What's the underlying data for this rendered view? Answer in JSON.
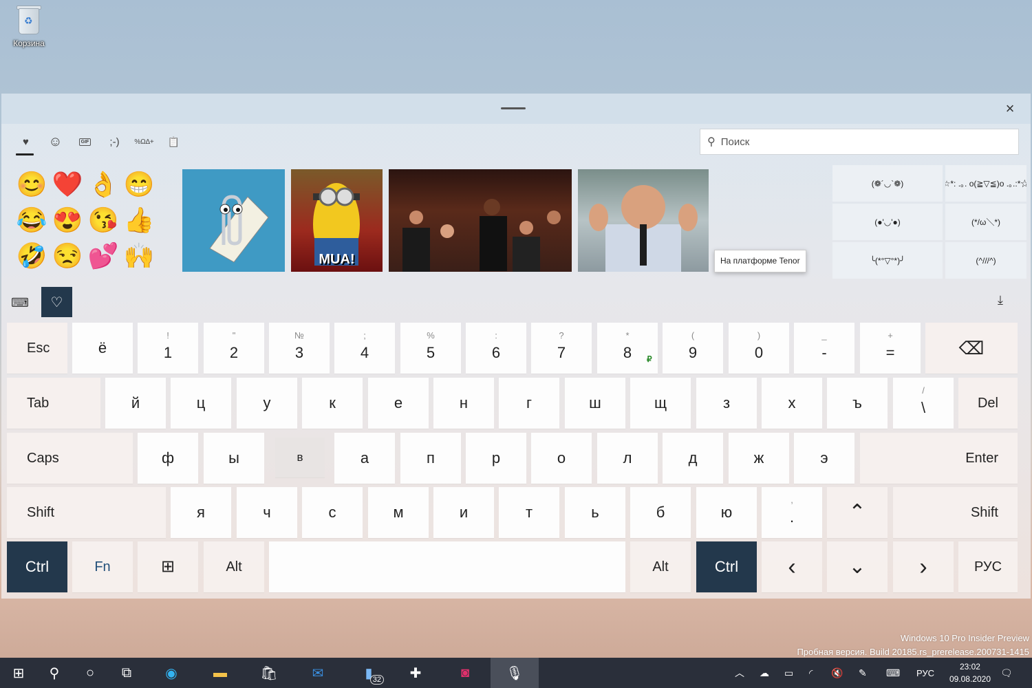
{
  "desktop": {
    "recycle_bin_label": "Корзина"
  },
  "panel": {
    "tabs": [
      {
        "name": "recent",
        "glyph": "♥"
      },
      {
        "name": "emoji",
        "glyph": "☺"
      },
      {
        "name": "gif",
        "glyph": "GIF"
      },
      {
        "name": "kaomoji",
        "glyph": ";-)"
      },
      {
        "name": "symbols",
        "glyph": "%Ω∆+"
      },
      {
        "name": "clipboard",
        "glyph": "📋"
      }
    ],
    "search_placeholder": "Поиск",
    "emojis": [
      "😊",
      "❤️",
      "👌",
      "😁",
      "😂",
      "😍",
      "😘",
      "👍",
      "🤣",
      "😒",
      "💕",
      "🙌"
    ],
    "gif_caption": "MUA!",
    "tenor_tooltip": "На платформе Tenor",
    "kaomoji": [
      "(❁´◡`❁)",
      "☆*: .｡. o(≧▽≦)o .｡.:*☆",
      "(●'◡'●)",
      "(*/ω＼*)",
      "╰(*°▽°*)╯",
      "(^///^)"
    ]
  },
  "keyboard": {
    "row1": [
      {
        "shift": "",
        "main": "Esc"
      },
      {
        "shift": "",
        "main": "ё"
      },
      {
        "shift": "!",
        "main": "1"
      },
      {
        "shift": "\"",
        "main": "2"
      },
      {
        "shift": "№",
        "main": "3"
      },
      {
        "shift": ";",
        "main": "4"
      },
      {
        "shift": "%",
        "main": "5"
      },
      {
        "shift": ":",
        "main": "6"
      },
      {
        "shift": "?",
        "main": "7"
      },
      {
        "shift": "*",
        "main": "8",
        "extra": "₽"
      },
      {
        "shift": "(",
        "main": "9"
      },
      {
        "shift": ")",
        "main": "0"
      },
      {
        "shift": "_",
        "main": "-"
      },
      {
        "shift": "+",
        "main": "="
      },
      {
        "shift": "",
        "main": "⌫"
      }
    ],
    "row2": [
      "Tab",
      "й",
      "ц",
      "у",
      "к",
      "е",
      "н",
      "г",
      "ш",
      "щ",
      "з",
      "х",
      "ъ",
      "\\",
      "Del"
    ],
    "row2_shift_backslash": "/",
    "row3": [
      "Caps",
      "ф",
      "ы",
      "в",
      "а",
      "п",
      "р",
      "о",
      "л",
      "д",
      "ж",
      "э",
      "Enter"
    ],
    "row4": [
      "Shift",
      "я",
      "ч",
      "с",
      "м",
      "и",
      "т",
      "ь",
      "б",
      "ю",
      ".",
      "⌃",
      "Shift"
    ],
    "row4_shift_dot": ",",
    "row5": [
      "Ctrl",
      "Fn",
      "⊞",
      "Alt",
      "",
      "Alt",
      "Ctrl",
      "‹",
      "⌄",
      "›",
      "РУС"
    ]
  },
  "watermark": {
    "line1": "Windows 10 Pro Insider Preview",
    "line2": "Пробная версия. Build 20185.rs_prerelease.200731-1415"
  },
  "taskbar": {
    "badge_count": "32",
    "lang": "РУС",
    "time": "23:02",
    "date": "09.08.2020"
  },
  "colors": {
    "dark_key": "#23384c",
    "taskbar": "#2a2f3a"
  }
}
